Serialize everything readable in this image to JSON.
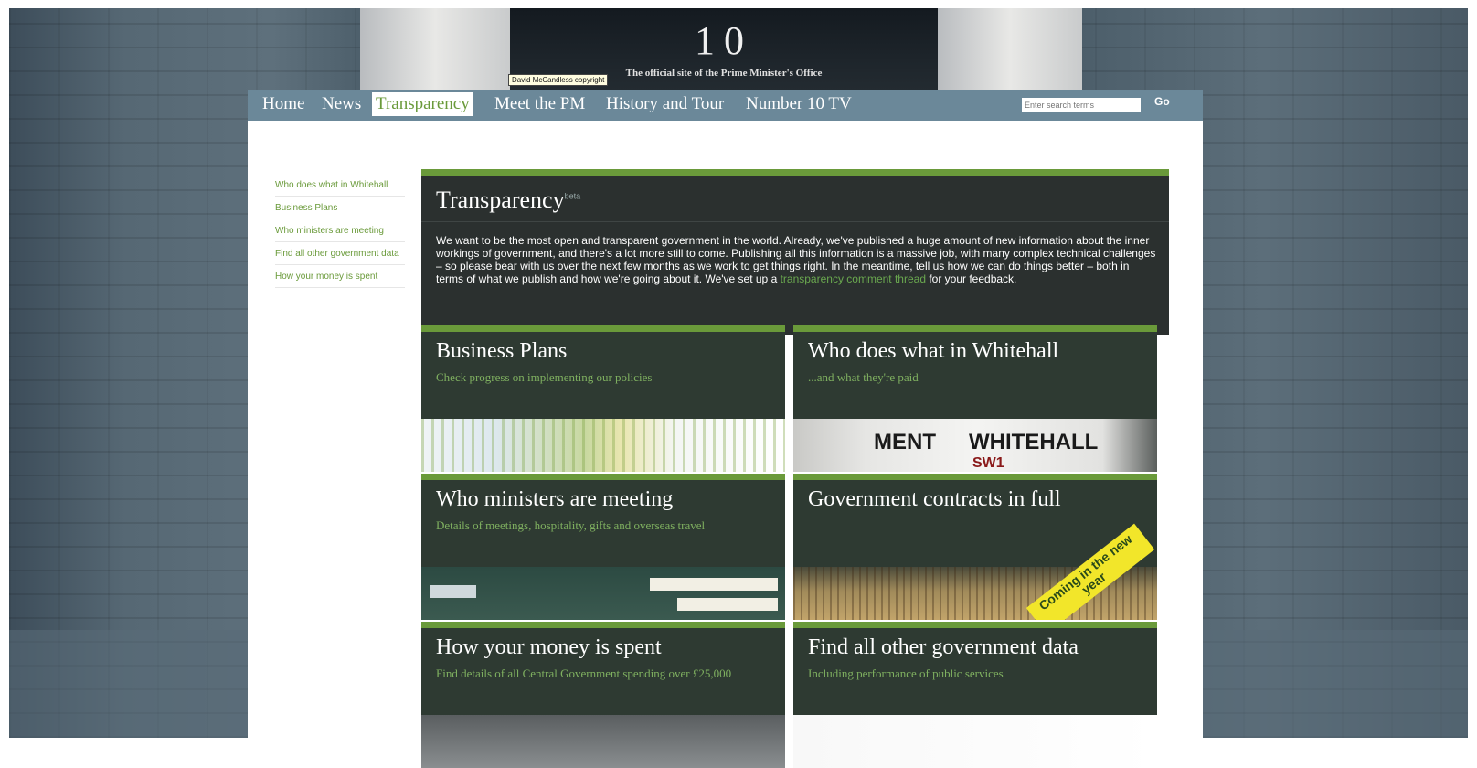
{
  "window": {
    "door_number": "10",
    "site_subtitle": "The official site of the Prime Minister's Office",
    "tooltip": "David McCandless copyright"
  },
  "nav": {
    "items": [
      "Home",
      "News",
      "Transparency",
      "Meet the PM",
      "History and Tour",
      "Number 10 TV"
    ],
    "active": "Transparency",
    "search_placeholder": "Enter search terms",
    "go_label": "Go"
  },
  "sidebar": {
    "items": [
      "Who does what in Whitehall",
      "Business Plans",
      "Who ministers are meeting",
      "Find all other government data",
      "How your money is spent"
    ]
  },
  "hero": {
    "title": "Transparency",
    "beta": "beta",
    "text_before_link": "We want to be the most open and transparent government in the world. Already, we've published a huge amount of new information about the inner workings of government, and there's a lot more still to come. Publishing all this information is a massive job, with many complex technical challenges – so please bear with us over the next few months as we work to get things right. In the meantime, tell us how we can do things better – both in terms of what we publish and how we're going about it. We've set up a ",
    "link_text": "transparency comment thread",
    "text_after_link": " for your feedback."
  },
  "cards": [
    {
      "title": "Business Plans",
      "subtitle": "Check progress on implementing our policies"
    },
    {
      "title": "Who does what in Whitehall",
      "subtitle": "...and what they're paid",
      "sign_left": "MENT",
      "sign_right": "WHITEHALL",
      "sign_code": "SW1"
    },
    {
      "title": "Who ministers are meeting",
      "subtitle": "Details of meetings, hospitality, gifts and overseas travel"
    },
    {
      "title": "Government contracts in full",
      "subtitle": "",
      "ribbon": "Coming in the new year"
    },
    {
      "title": "How your money is spent",
      "subtitle": "Find details of all Central Government spending over £25,000"
    },
    {
      "title": "Find all other government data",
      "subtitle": "Including performance of public services"
    }
  ],
  "colors": {
    "nav_bar": "#6b8899",
    "accent_green": "#6a9a3a",
    "hero_bg": "#2b302f",
    "card_bg": "#2e3a32",
    "ribbon_yellow": "#f2e62a"
  }
}
